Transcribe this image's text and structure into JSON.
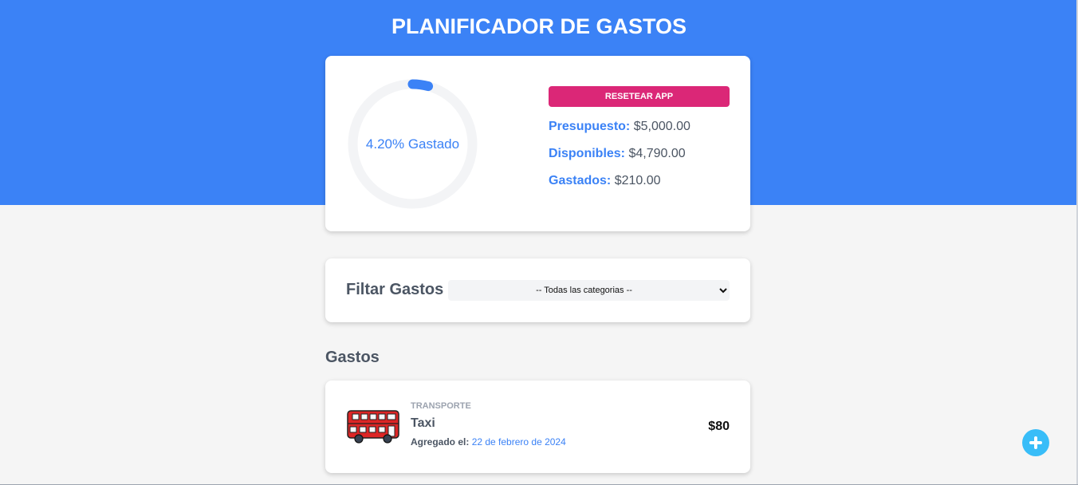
{
  "app": {
    "title": "PLANIFICADOR DE GASTOS"
  },
  "budget": {
    "percent_spent": 4.2,
    "progress_text": "4.20% Gastado",
    "reset_label": "Resetear App",
    "presupuesto_label": "Presupuesto:",
    "presupuesto_value": "$5,000.00",
    "disponibles_label": "Disponibles:",
    "disponibles_value": "$4,790.00",
    "gastados_label": "Gastados:",
    "gastados_value": "$210.00",
    "colors": {
      "accent": "#3b82f6",
      "track": "#f3f4f6",
      "reset": "#db2777"
    }
  },
  "filter": {
    "label": "Filtar Gastos",
    "selected": "-- Todas las categorias --"
  },
  "expenses": {
    "title": "Gastos",
    "items": [
      {
        "icon": "bus-icon",
        "category": "TRANSPORTE",
        "name": "Taxi",
        "date_label": "Agregado el:",
        "date_value": "22 de febrero de 2024",
        "amount": "$80"
      }
    ]
  },
  "add_button": {
    "icon": "plus-icon",
    "color": "#38bdf8"
  }
}
